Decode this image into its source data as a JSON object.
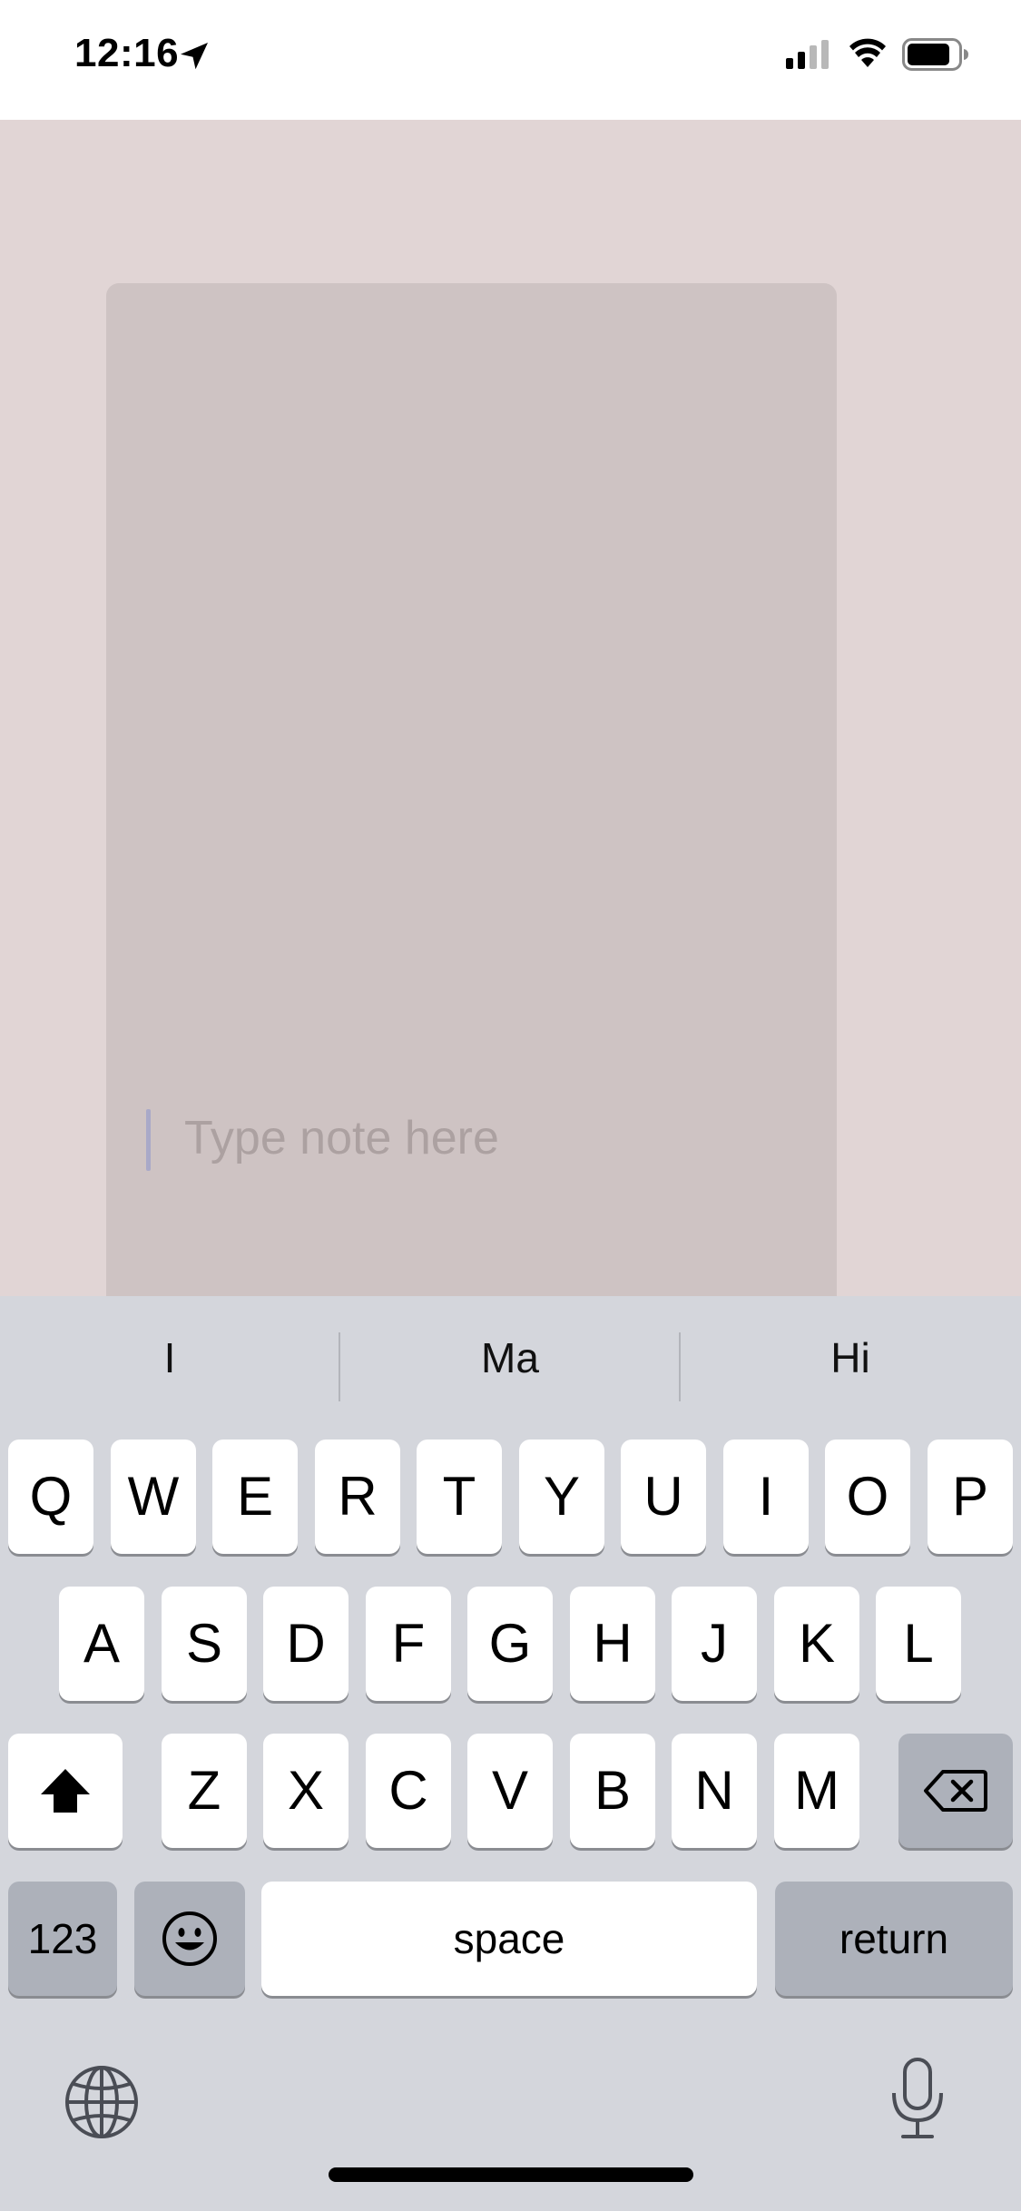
{
  "status_bar": {
    "time": "12:16",
    "icons": [
      "location-arrow-icon",
      "cellular-signal-icon",
      "wifi-icon",
      "battery-icon"
    ]
  },
  "note": {
    "placeholder": "Type note here",
    "value": ""
  },
  "keyboard": {
    "suggestions": [
      "I",
      "Ma",
      "Hi"
    ],
    "row1": [
      "Q",
      "W",
      "E",
      "R",
      "T",
      "Y",
      "U",
      "I",
      "O",
      "P"
    ],
    "row2": [
      "A",
      "S",
      "D",
      "F",
      "G",
      "H",
      "J",
      "K",
      "L"
    ],
    "row3": [
      "Z",
      "X",
      "C",
      "V",
      "B",
      "N",
      "M"
    ],
    "numbers_label": "123",
    "space_label": "space",
    "return_label": "return",
    "icons": [
      "shift-icon",
      "backspace-icon",
      "emoji-icon",
      "globe-icon",
      "microphone-icon"
    ]
  },
  "colors": {
    "canvas_bg": "#e1d5d5",
    "card_bg": "#cec3c3",
    "keyboard_bg": "#d4d6dc",
    "key_bg": "#ffffff",
    "special_key_bg": "#adb1ba"
  }
}
